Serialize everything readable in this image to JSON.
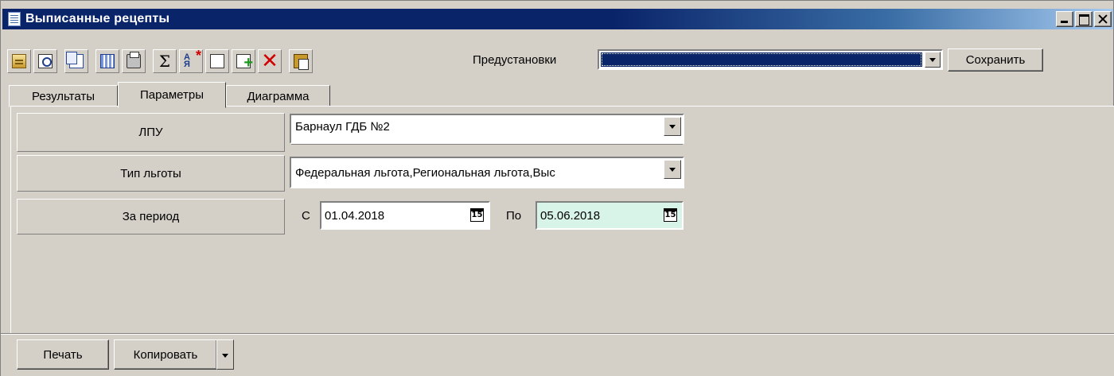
{
  "window": {
    "title": "Выписанные рецепты",
    "controls": [
      "minimize-icon",
      "maximize-icon",
      "close-icon"
    ]
  },
  "toolbar": {
    "buttons": [
      {
        "icon": "properties-icon"
      },
      {
        "icon": "print-preview-icon"
      },
      {
        "icon": "copy-icon"
      },
      {
        "icon": "calculator-icon"
      },
      {
        "icon": "printer-icon"
      },
      {
        "icon": "sum-icon",
        "glyph": "Σ"
      },
      {
        "icon": "sort-icon",
        "glyph": "А Я"
      },
      {
        "icon": "new-document-icon"
      },
      {
        "icon": "add-document-icon"
      },
      {
        "icon": "delete-icon",
        "glyph": "✕"
      },
      {
        "icon": "paste-icon"
      }
    ],
    "presets_label": "Предустановки",
    "presets_value": "",
    "save_label": "Сохранить"
  },
  "tabs": [
    {
      "label": "Результаты",
      "active": false
    },
    {
      "label": "Параметры",
      "active": true
    },
    {
      "label": "Диаграмма",
      "active": false
    }
  ],
  "params": {
    "lpu_label": "ЛПУ",
    "lpu_value": "Барнаул ГДБ №2",
    "benefit_label": "Тип льготы",
    "benefit_value": "Федеральная льгота,Региональная льгота,Выс",
    "period_label": "За период",
    "from_label": "С",
    "from_date": "01.04.2018",
    "to_label": "По",
    "to_date": "05.06.2018",
    "calendar_glyph": "15"
  },
  "bottom": {
    "print_label": "Печать",
    "copy_label": "Копировать"
  },
  "colors": {
    "titlebar": "#0a246a",
    "face": "#d4d0c8",
    "to_date_bg": "#d8f3e8"
  }
}
